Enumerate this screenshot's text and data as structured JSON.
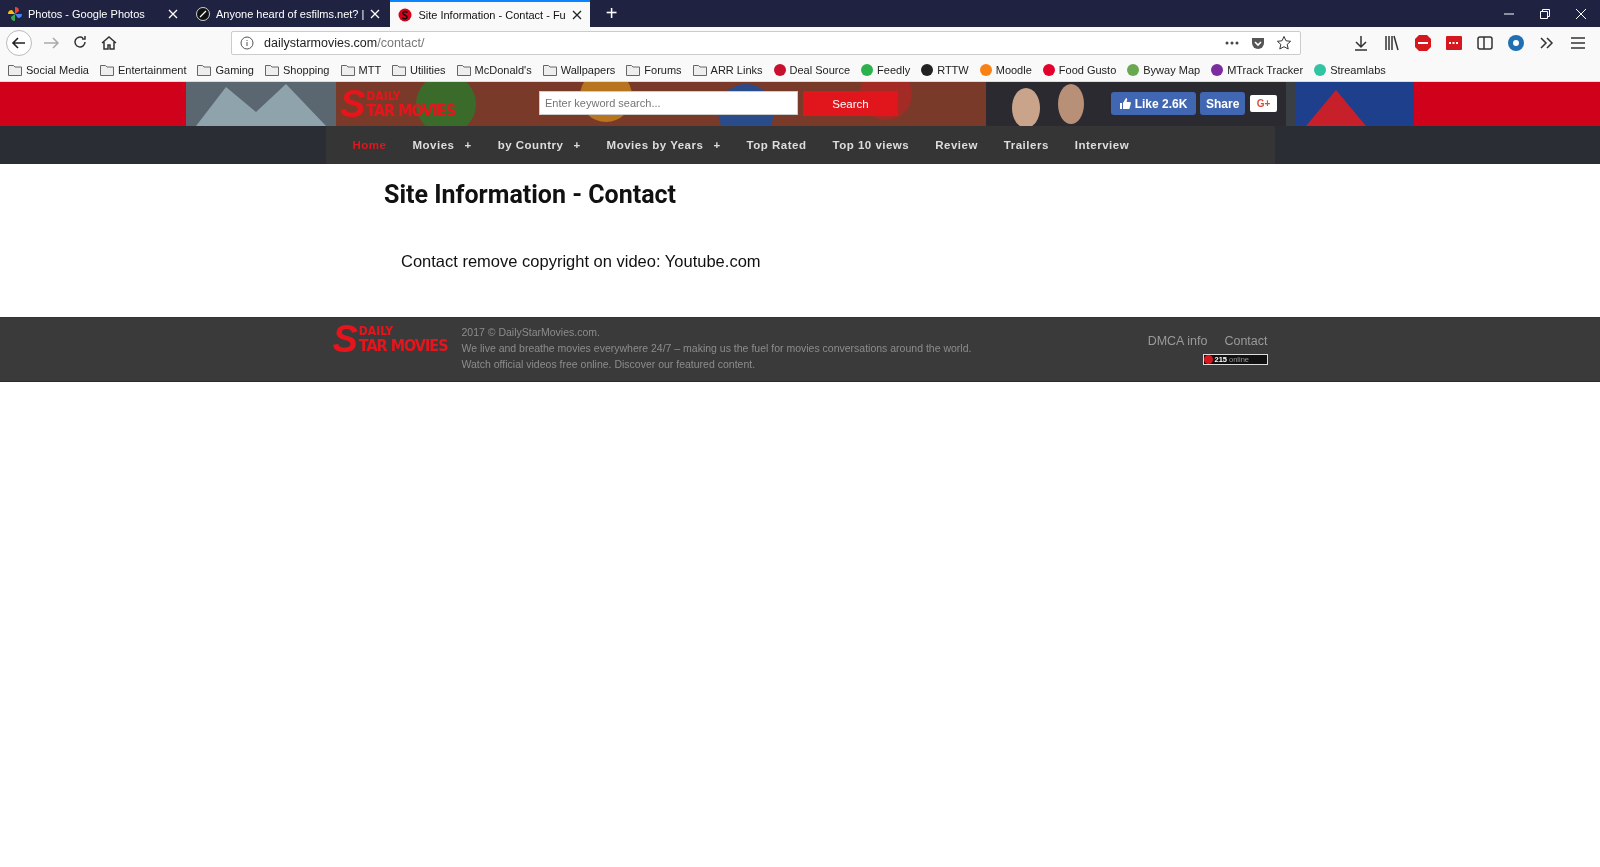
{
  "browser": {
    "tabs": [
      {
        "title": "Photos - Google Photos",
        "selected": false
      },
      {
        "title": "Anyone heard of esfilms.net? |",
        "selected": false
      },
      {
        "title": "Site Information - Contact - Fu",
        "selected": true
      }
    ],
    "new_tab": "+",
    "address": {
      "domain": "dailystarmovies.com",
      "path": "/contact/"
    },
    "bookmarks": [
      {
        "label": "Social Media",
        "kind": "folder"
      },
      {
        "label": "Entertainment",
        "kind": "folder"
      },
      {
        "label": "Gaming",
        "kind": "folder"
      },
      {
        "label": "Shopping",
        "kind": "folder"
      },
      {
        "label": "MTT",
        "kind": "folder"
      },
      {
        "label": "Utilities",
        "kind": "folder"
      },
      {
        "label": "McDonald's",
        "kind": "folder"
      },
      {
        "label": "Wallpapers",
        "kind": "folder"
      },
      {
        "label": "Forums",
        "kind": "folder"
      },
      {
        "label": "ARR Links",
        "kind": "folder"
      },
      {
        "label": "Deal Source",
        "kind": "site",
        "color": "#c8102e"
      },
      {
        "label": "Feedly",
        "kind": "site",
        "color": "#2bb24c"
      },
      {
        "label": "RTTW",
        "kind": "site",
        "color": "#222222"
      },
      {
        "label": "Moodle",
        "kind": "site",
        "color": "#f98012"
      },
      {
        "label": "Food Gusto",
        "kind": "site",
        "color": "#e4002b"
      },
      {
        "label": "Byway Map",
        "kind": "site",
        "color": "#6aa84f"
      },
      {
        "label": "MTrack Tracker",
        "kind": "site",
        "color": "#7b2c9e"
      },
      {
        "label": "Streamlabs",
        "kind": "site",
        "color": "#31c3a2"
      }
    ]
  },
  "site": {
    "logo": {
      "letter": "S",
      "top": "DAILY",
      "bottom": "TAR MOVIES"
    },
    "search": {
      "placeholder": "Enter keyword search...",
      "button": "Search"
    },
    "social": {
      "like": "Like 2.6K",
      "share": "Share",
      "gplus": "G+"
    },
    "nav": [
      {
        "label": "Home",
        "selected": true
      },
      {
        "label": "Movies",
        "selected": false,
        "expander": "+"
      },
      {
        "label": "by Country",
        "selected": false,
        "expander": "+"
      },
      {
        "label": "Movies by Years",
        "selected": false,
        "expander": "+"
      },
      {
        "label": "Top Rated",
        "selected": false
      },
      {
        "label": "Top 10 views",
        "selected": false
      },
      {
        "label": "Review",
        "selected": false
      },
      {
        "label": "Trailers",
        "selected": false
      },
      {
        "label": "Interview",
        "selected": false
      }
    ],
    "heading": "Site Information - Contact",
    "body": "Contact remove copyright on video: Youtube.com",
    "footer": {
      "logo": {
        "letter": "S",
        "top": "DAILY",
        "bottom": "TAR MOVIES"
      },
      "lines": [
        "2017 © DailyStarMovies.com.",
        "We live and breathe movies everywhere 24/7 – making us the fuel for movies conversations around the world.",
        "Watch official videos free online. Discover our featured content."
      ],
      "links": [
        "DMCA info",
        "Contact"
      ],
      "counter": {
        "count": "215",
        "label": "online"
      }
    }
  }
}
